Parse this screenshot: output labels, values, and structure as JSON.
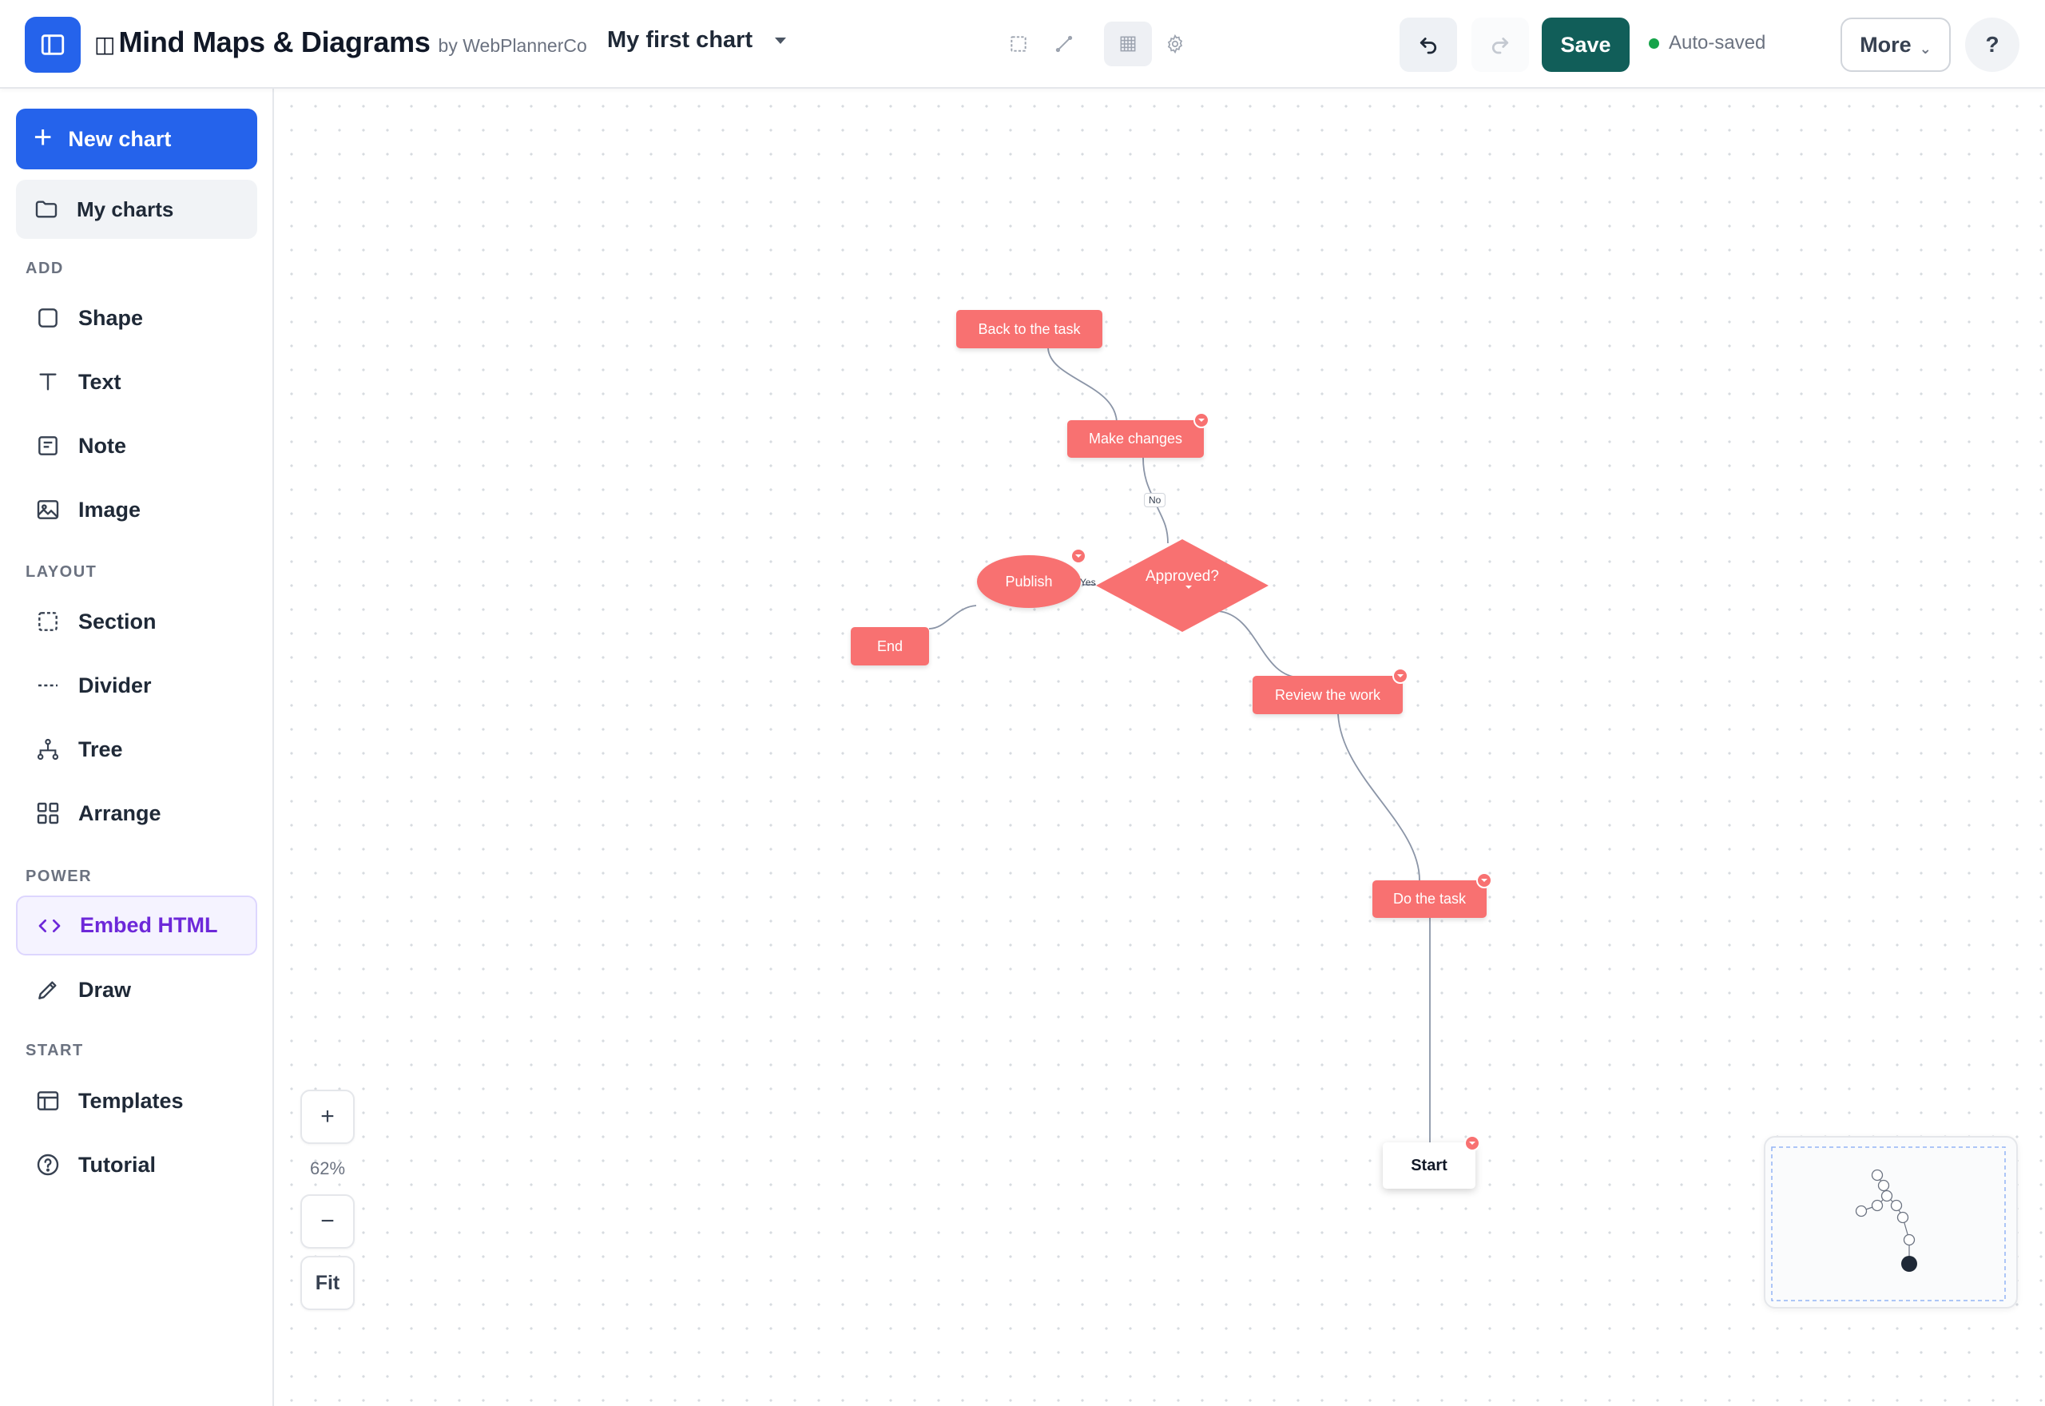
{
  "app": {
    "brand_glyph": "◫",
    "title": "Mind Maps & Diagrams",
    "by": "by WebPlannerCo"
  },
  "chart_selector": {
    "current": "My first chart"
  },
  "toolbar": {
    "tools": [
      "select-tool",
      "connector-tool",
      "grid-tool",
      "settings-tool"
    ],
    "save_label": "Save",
    "autosave_label": "Auto-saved",
    "more_label": "More",
    "more_chevron": "⌄",
    "help_label": "?"
  },
  "sidebar": {
    "new_chart_label": "New chart",
    "new_chart_plus": "+",
    "my_charts_label": "My charts",
    "sections": {
      "add": "ADD",
      "layout": "LAYOUT",
      "power": "POWER",
      "start": "START"
    },
    "add_items": [
      {
        "label": "Shape",
        "icon": "square-icon"
      },
      {
        "label": "Text",
        "icon": "text-icon"
      },
      {
        "label": "Note",
        "icon": "note-icon"
      },
      {
        "label": "Image",
        "icon": "image-icon"
      }
    ],
    "layout_items": [
      {
        "label": "Section",
        "icon": "section-icon"
      },
      {
        "label": "Divider",
        "icon": "divider-icon"
      },
      {
        "label": "Tree",
        "icon": "tree-icon"
      },
      {
        "label": "Arrange",
        "icon": "grid-icon"
      }
    ],
    "power_items": [
      {
        "label": "Embed HTML",
        "icon": "code-icon"
      },
      {
        "label": "Draw",
        "icon": "pencil-icon"
      }
    ],
    "start_items": [
      {
        "label": "Templates",
        "icon": "template-icon"
      },
      {
        "label": "Tutorial",
        "icon": "help-circle-icon"
      }
    ]
  },
  "diagram": {
    "nodes": {
      "back_to_task": "Back to the task",
      "make_changes": "Make changes",
      "approved": "Approved?",
      "publish": "Publish",
      "end": "End",
      "review": "Review the work",
      "do_task": "Do the task",
      "start": "Start"
    },
    "edge_labels": {
      "no": "No",
      "yes": "Yes"
    },
    "node_color": "#f87171"
  },
  "zoom": {
    "in_label": "+",
    "level": "62%",
    "out_label": "−",
    "fit_label": "Fit"
  },
  "colors": {
    "accent": "#2563eb",
    "save": "#115e59",
    "embed": "#6d28d9",
    "autosave_dot": "#16a34a"
  }
}
